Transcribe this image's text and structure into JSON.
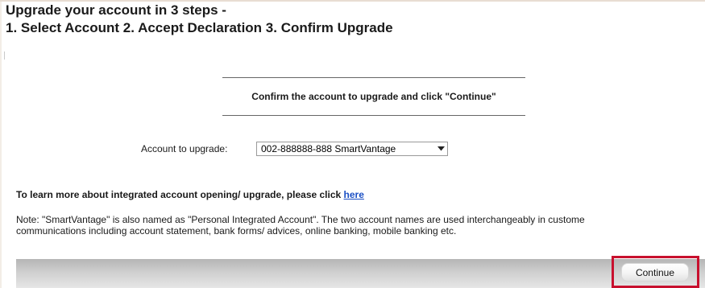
{
  "page": {
    "title_line1": "Upgrade your account in 3 steps -",
    "title_line2": "1. Select Account 2. Accept Declaration 3. Confirm Upgrade"
  },
  "instruction": {
    "text": "Confirm the account to upgrade and click \"Continue\""
  },
  "account_selector": {
    "label": "Account to upgrade:",
    "selected_value": "002-888888-888 SmartVantage",
    "arrow_icon": "chevron-down-icon"
  },
  "learn_more": {
    "text": "To learn more about integrated account opening/ upgrade, please click",
    "link_label": "here"
  },
  "note": {
    "line1": "Note: \"SmartVantage\" is also named as \"Personal Integrated Account\". The two account names are used interchangeably in custome",
    "line2": "communications including account statement, bank forms/ advices, online banking, mobile banking etc."
  },
  "actions": {
    "continue_label": "Continue",
    "highlight_color": "#c8102e"
  }
}
